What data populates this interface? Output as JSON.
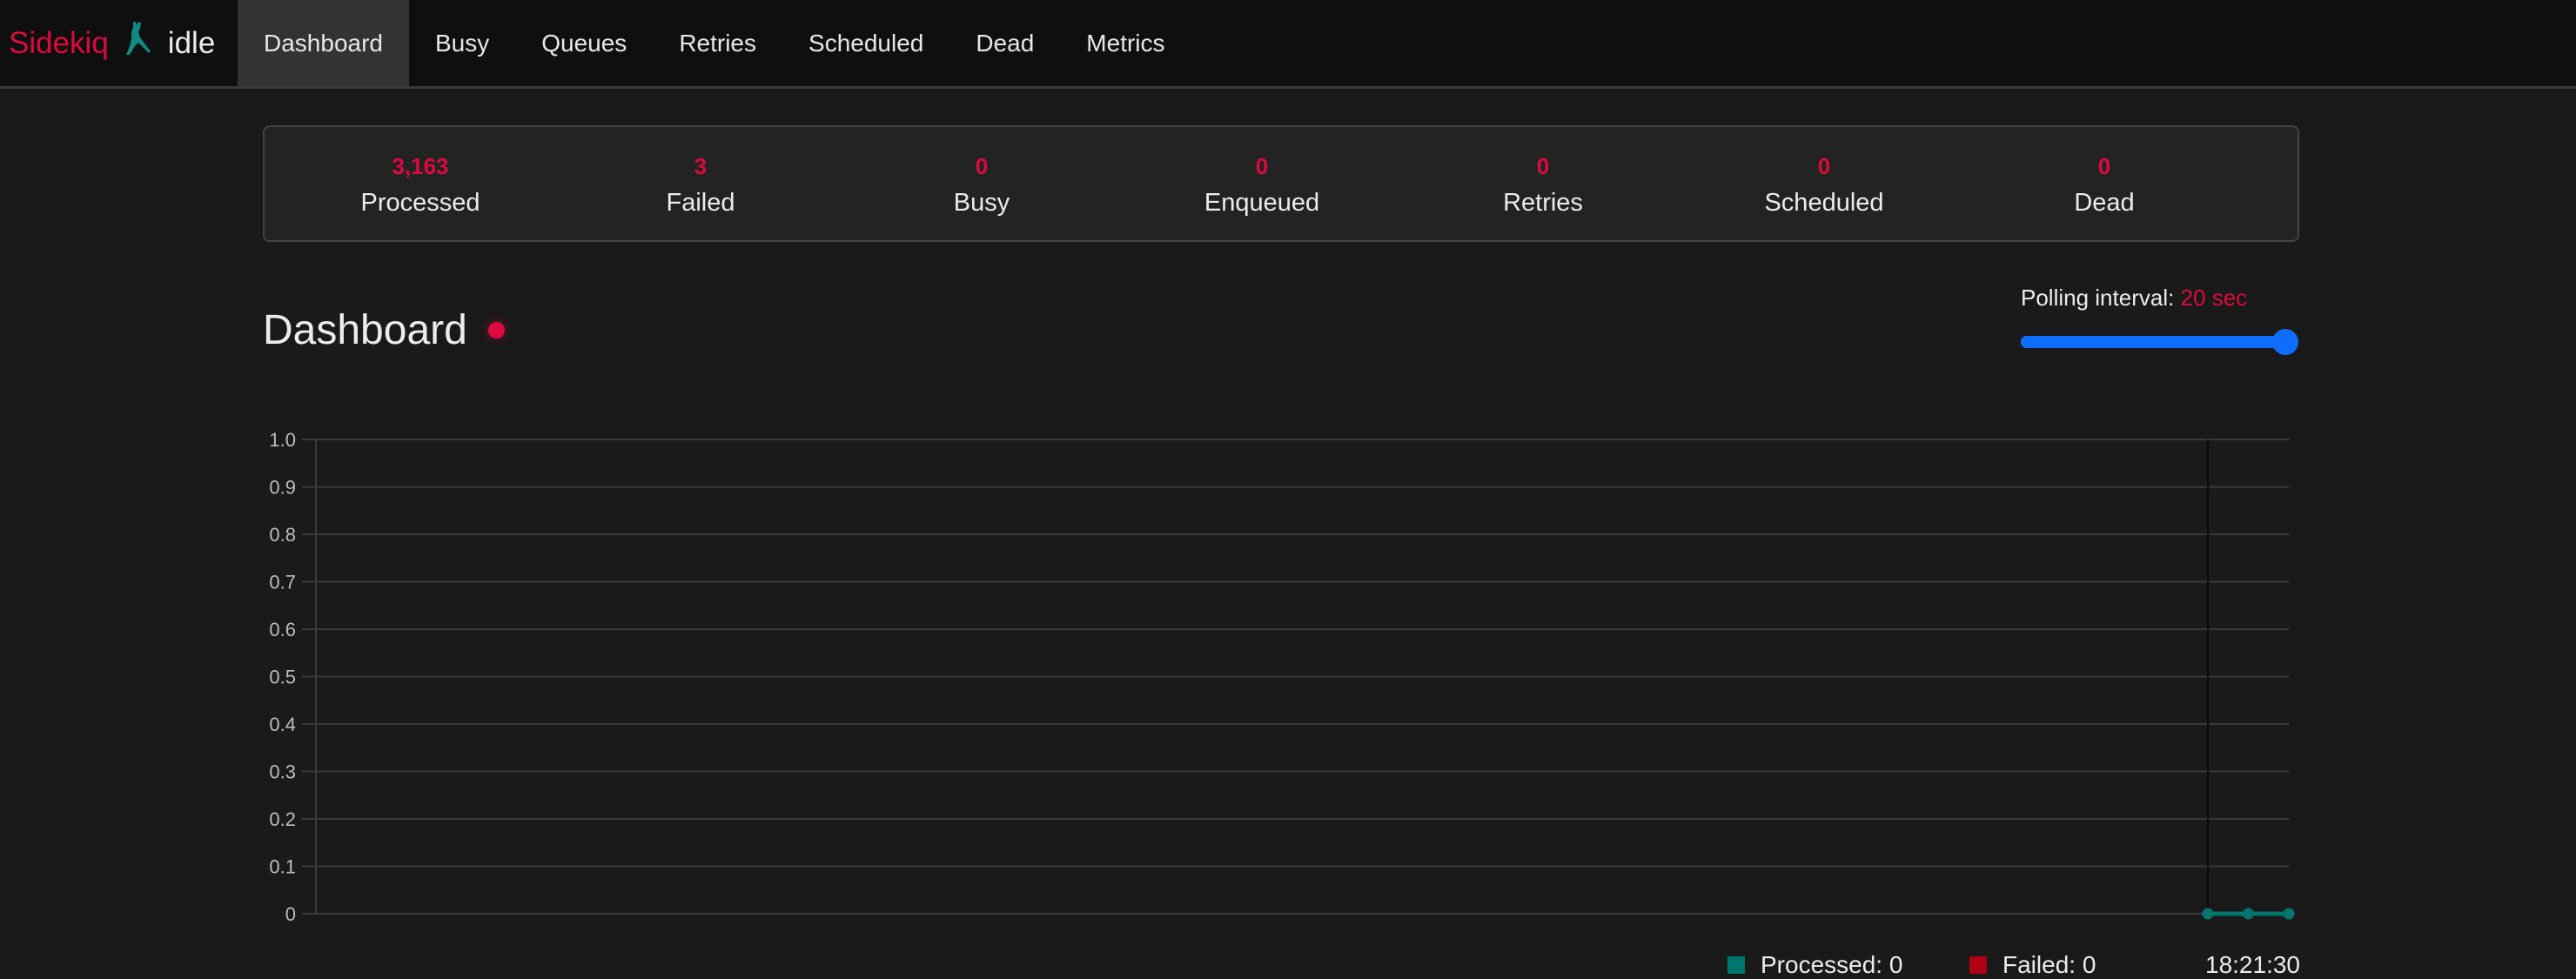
{
  "brand": {
    "name": "Sidekiq",
    "logo_icon": "sidekiq-ninja-logo",
    "status": "idle"
  },
  "nav": {
    "items": [
      {
        "label": "Dashboard",
        "active": true
      },
      {
        "label": "Busy",
        "active": false
      },
      {
        "label": "Queues",
        "active": false
      },
      {
        "label": "Retries",
        "active": false
      },
      {
        "label": "Scheduled",
        "active": false
      },
      {
        "label": "Dead",
        "active": false
      },
      {
        "label": "Metrics",
        "active": false
      }
    ]
  },
  "stats": [
    {
      "value": "3,163",
      "label": "Processed"
    },
    {
      "value": "3",
      "label": "Failed"
    },
    {
      "value": "0",
      "label": "Busy"
    },
    {
      "value": "0",
      "label": "Enqueued"
    },
    {
      "value": "0",
      "label": "Retries"
    },
    {
      "value": "0",
      "label": "Scheduled"
    },
    {
      "value": "0",
      "label": "Dead"
    }
  ],
  "page": {
    "title": "Dashboard",
    "beacon_icon": "live-beacon-dot"
  },
  "polling": {
    "label": "Polling interval:",
    "value_text": "20 sec",
    "value": 20,
    "min": 2,
    "max": 20
  },
  "colors": {
    "accent": "#dc0a3e",
    "processed": "#00766e",
    "failed": "#af0014",
    "slider": "#0d6efd"
  },
  "chart_data": {
    "type": "line",
    "title": "",
    "xlabel": "",
    "ylabel": "",
    "ylim": [
      0,
      1.0
    ],
    "yticks": [
      "1.0",
      "0.9",
      "0.8",
      "0.7",
      "0.6",
      "0.5",
      "0.4",
      "0.3",
      "0.2",
      "0.1",
      "0"
    ],
    "grid": true,
    "series": [
      {
        "name": "Processed",
        "color": "#00766e",
        "values": [
          0,
          0,
          0
        ]
      },
      {
        "name": "Failed",
        "color": "#af0014",
        "values": [
          0,
          0,
          0
        ]
      }
    ],
    "tooltip": {
      "entries": [
        {
          "label": "Processed: 0",
          "color": "#00766e"
        },
        {
          "label": "Failed: 0",
          "color": "#af0014"
        }
      ],
      "time": "18:21:30"
    }
  }
}
